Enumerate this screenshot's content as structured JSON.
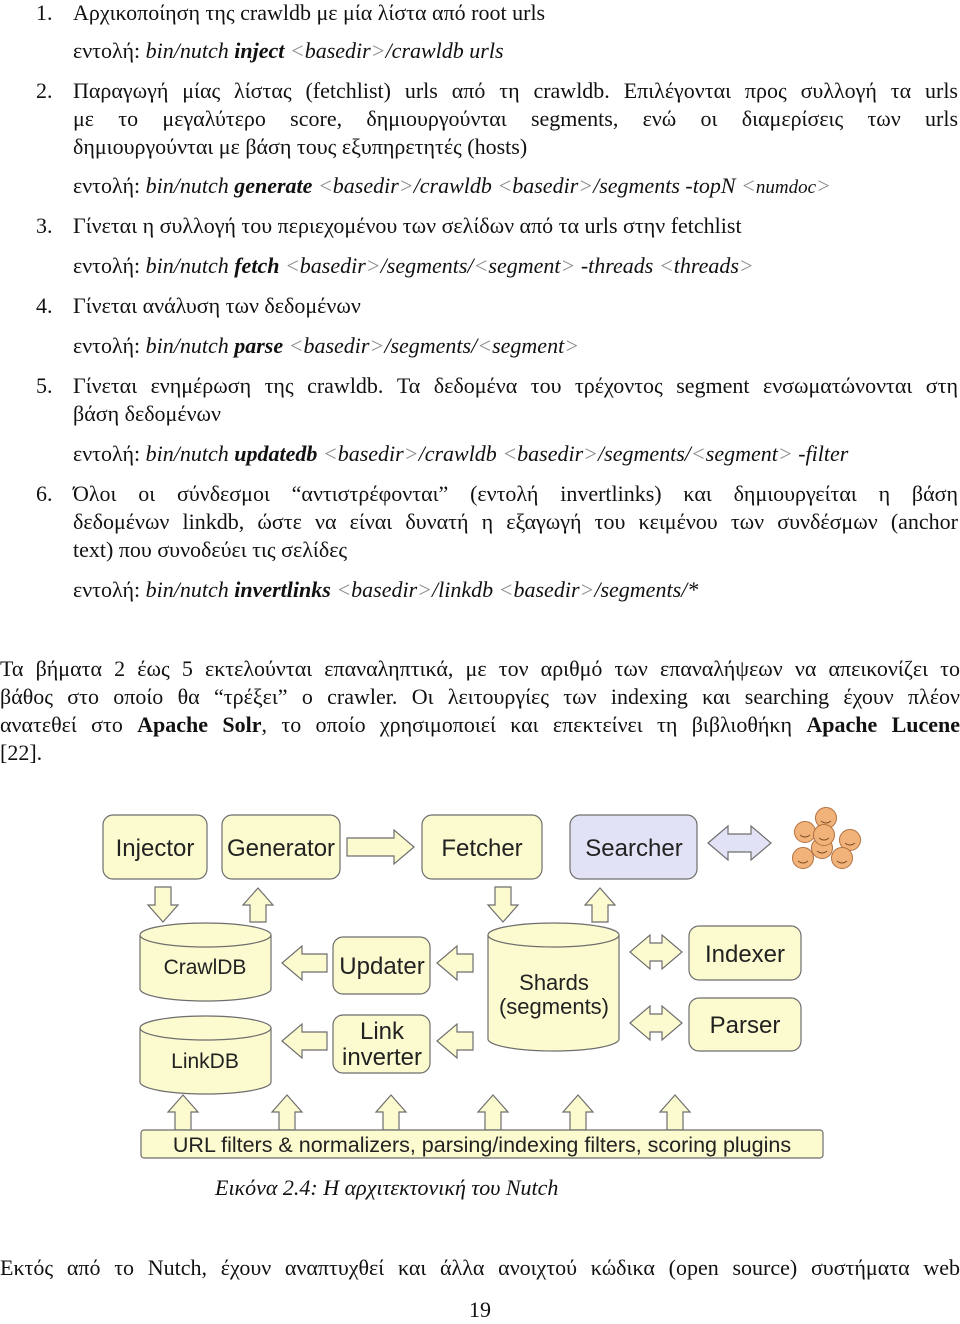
{
  "steps": [
    {
      "num": "1.",
      "lines": [
        "Αρχικοποίηση της crawldb με μία λίστα από root urls"
      ],
      "cmd": {
        "prefix": "εντολή: ",
        "prog": "bin/nutch ",
        "verb": "inject",
        "args": " <basedir>/crawldb urls"
      }
    },
    {
      "num": "2.",
      "lines": [
        "Παραγωγή μίας λίστας (fetchlist) urls από τη crawldb. Επιλέγονται προς συλλογή τα urls",
        "με το μεγαλύτερο score, δημιουργούνται segments, ενώ οι διαμερίσεις των urls",
        "δημιουργούνται με βάση τους εξυπηρετητές (hosts)"
      ],
      "cmd": {
        "prefix": "εντολή: ",
        "prog": "bin/nutch ",
        "verb": "generate",
        "args": " <basedir>/crawldb <basedir>/segments -topN <numdoc>"
      }
    },
    {
      "num": "3.",
      "lines": [
        "Γίνεται η συλλογή του περιεχομένου των σελίδων από τα urls στην fetchlist"
      ],
      "cmd": {
        "prefix": "εντολή: ",
        "prog": "bin/nutch ",
        "verb": "fetch",
        "args": " <basedir>/segments/<segment> -threads <threads>"
      }
    },
    {
      "num": "4.",
      "lines": [
        "Γίνεται ανάλυση των δεδομένων"
      ],
      "cmd": {
        "prefix": "εντολή: ",
        "prog": "bin/nutch ",
        "verb": "parse",
        "args": " <basedir>/segments/<segment>"
      }
    },
    {
      "num": "5.",
      "lines": [
        "Γίνεται ενημέρωση της crawldb. Τα δεδομένα του τρέχοντος segment ενσωματώνονται στη",
        "βάση δεδομένων"
      ],
      "cmd": {
        "prefix": "εντολή: ",
        "prog": "bin/nutch ",
        "verb": "updatedb",
        "args": " <basedir>/crawldb <basedir>/segments/<segment> -filter"
      }
    },
    {
      "num": "6.",
      "lines": [
        "Όλοι οι σύνδεσμοι “αντιστρέφονται” (εντολή invertlinks) και δημιουργείται η βάση",
        "δεδομένων linkdb, ώστε να είναι δυνατή η εξαγωγή του κειμένου των συνδέσμων (anchor",
        "text) που συνοδεύει τις σελίδες"
      ],
      "cmd": {
        "prefix": "εντολή: ",
        "prog": "bin/nutch ",
        "verb": "invertlinks",
        "args": " <basedir>/linkdb <basedir>/segments/*"
      }
    }
  ],
  "paragraph": {
    "l1": "Τα βήματα 2 έως 5 εκτελούνται επαναληπτικά, με τον αριθμό των επαναλήψεων να απεικονίζει το",
    "l2": "βάθος στο οποίο θα “τρέξει” ο crawler. Οι λειτουργίες των indexing και searching έχουν πλέον",
    "l3a": "ανατεθεί στο ",
    "l3b": "Apache Solr",
    "l3c": ", το οποίο χρησιμοποιεί και επεκτείνει τη βιβλιοθήκη ",
    "l3d": "Apache Lucene",
    "l4": "[22]."
  },
  "diagram": {
    "boxes": {
      "injector": "Injector",
      "generator": "Generator",
      "fetcher": "Fetcher",
      "searcher": "Searcher",
      "updater": "Updater",
      "link1": "Link",
      "link2": "inverter",
      "indexer": "Indexer",
      "parser": "Parser"
    },
    "dbs": {
      "crawldb": "CrawlDB",
      "linkdb": "LinkDB",
      "shards1": "Shards",
      "shards2": "(segments)"
    },
    "bar": "URL filters & normalizers, parsing/indexing filters, scoring plugins",
    "colors": {
      "fill": "#fbfbcf",
      "searcher_fill": "#e2e2f6",
      "stroke": "#6e6e6e",
      "users": "#f2b37a"
    }
  },
  "caption": "Εικόνα 2.4: Η αρχιτεκτονική του Nutch",
  "last_line": "Εκτός από το Nutch, έχουν αναπτυχθεί και άλλα ανοιχτού κώδικα (open source) συστήματα web",
  "page_number": "19"
}
